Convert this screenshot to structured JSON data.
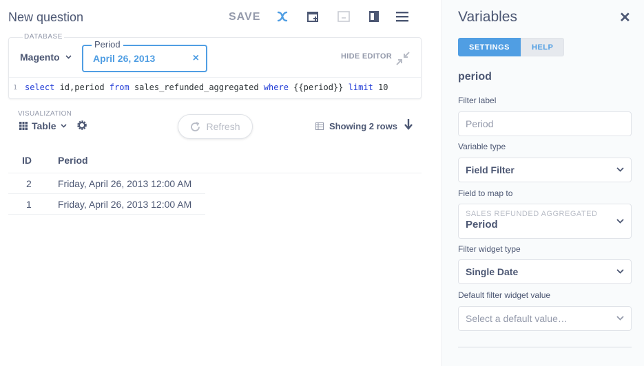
{
  "header": {
    "title": "New question",
    "save_label": "SAVE",
    "icons": [
      "variable-x-icon",
      "add-to-dashboard-icon",
      "embed-icon",
      "notebook-icon",
      "menu-icon"
    ]
  },
  "editor": {
    "database_label": "DATABASE",
    "database_value": "Magento",
    "period_label": "Period",
    "period_value": "April 26, 2013",
    "hide_editor": "HIDE EDITOR",
    "line_number": "1",
    "sql": {
      "kw_select": "select",
      "t1": " id,period",
      "kw_from": " from",
      "t2": " sales_refunded_aggregated",
      "kw_where": " where",
      "t3": " {{period}}",
      "kw_limit": " limit",
      "t4": " 10"
    }
  },
  "visualization": {
    "label": "VISUALIZATION",
    "type": "Table",
    "refresh_label": "Refresh",
    "row_count": "Showing 2 rows"
  },
  "results": {
    "columns": [
      "ID",
      "Period"
    ],
    "rows": [
      [
        "2",
        "Friday, April 26, 2013 12:00 AM"
      ],
      [
        "1",
        "Friday, April 26, 2013 12:00 AM"
      ]
    ]
  },
  "sidebar": {
    "title": "Variables",
    "tabs": [
      {
        "label": "SETTINGS",
        "active": true
      },
      {
        "label": "HELP",
        "active": false
      }
    ],
    "variable_name": "period",
    "filter_label_title": "Filter label",
    "filter_label_placeholder": "Period",
    "variable_type_title": "Variable type",
    "variable_type_value": "Field Filter",
    "field_map_title": "Field to map to",
    "field_map_table": "SALES REFUNDED AGGREGATED",
    "field_map_field": "Period",
    "widget_type_title": "Filter widget type",
    "widget_type_value": "Single Date",
    "default_value_title": "Default filter widget value",
    "default_value_placeholder": "Select a default value…"
  },
  "colors": {
    "accent": "#509ee3",
    "text": "#4c5773",
    "muted": "#949aab",
    "sql_keyword": "#1f3ad6"
  }
}
